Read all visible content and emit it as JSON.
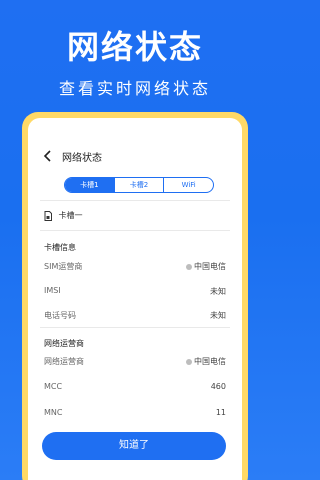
{
  "hero": {
    "title": "网络状态",
    "subtitle": "查看实时网络状态"
  },
  "nav": {
    "title": "网络状态"
  },
  "tabs": [
    {
      "label": "卡槽1",
      "active": true
    },
    {
      "label": "卡槽2",
      "active": false
    },
    {
      "label": "WiFi",
      "active": false
    }
  ],
  "sim_slot": {
    "label": "卡槽一"
  },
  "card_info": {
    "title": "卡槽信息",
    "rows": [
      {
        "label": "SIM运营商",
        "value": "中国电信"
      },
      {
        "label": "IMSI",
        "value": "未知"
      },
      {
        "label": "电话号码",
        "value": "未知"
      }
    ]
  },
  "network_operator": {
    "title": "网络运营商",
    "rows": [
      {
        "label": "网络运营商",
        "value": "中国电信"
      },
      {
        "label": "MCC",
        "value": "460"
      },
      {
        "label": "MNC",
        "value": "11"
      }
    ]
  },
  "button": {
    "ok_label": "知道了"
  },
  "colors": {
    "brand": "#1f6ff2",
    "frame": "#ffd966"
  }
}
